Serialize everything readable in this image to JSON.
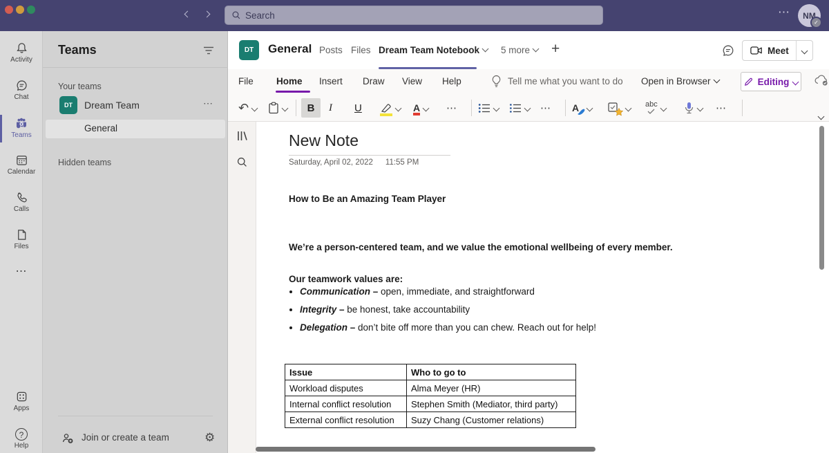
{
  "glyphs": {
    "ellipsis": "⋯",
    "plus": "+",
    "undo": "↶",
    "question": "?",
    "gear": "⚙",
    "check": "✓"
  },
  "colors": {
    "titlebar_bg": "#454370",
    "teams_accent": "#6062a5",
    "onenote_purple": "#7719aa",
    "team_avatar_teal": "#1a7d70",
    "traffic_red": "#d35d52",
    "traffic_yellow": "#cf9b3e",
    "traffic_green": "#2f8a5f"
  },
  "titlebar": {
    "search_placeholder": "Search",
    "avatar_initials": "NM"
  },
  "rail": {
    "items": [
      {
        "label": "Activity"
      },
      {
        "label": "Chat"
      },
      {
        "label": "Teams"
      },
      {
        "label": "Calendar"
      },
      {
        "label": "Calls"
      },
      {
        "label": "Files"
      }
    ],
    "bottom_items": [
      {
        "label": "Apps"
      },
      {
        "label": "Help"
      }
    ]
  },
  "sidebar": {
    "title": "Teams",
    "your_teams_label": "Your teams",
    "team": {
      "initials": "DT",
      "name": "Dream Team"
    },
    "channel": "General",
    "hidden_teams_label": "Hidden teams",
    "join_label": "Join or create a team"
  },
  "channel_header": {
    "team_initials": "DT",
    "title": "General",
    "tabs": [
      {
        "label": "Posts"
      },
      {
        "label": "Files"
      },
      {
        "label": "Dream Team Notebook"
      }
    ],
    "more_tabs_label": "5 more",
    "meet_label": "Meet"
  },
  "ribbon": {
    "menus": [
      {
        "label": "File"
      },
      {
        "label": "Home"
      },
      {
        "label": "Insert"
      },
      {
        "label": "Draw"
      },
      {
        "label": "View"
      },
      {
        "label": "Help"
      }
    ],
    "tell_me_label": "Tell me what you want to do",
    "open_in_browser_label": "Open in Browser",
    "editing_label": "Editing"
  },
  "toolbar": {
    "bold_label": "B",
    "italic_label": "I",
    "underline_label": "U",
    "fontcolor_label": "A",
    "styles_label": "A",
    "abc_label": "abc"
  },
  "note": {
    "title": "New Note",
    "date": "Saturday, April 02, 2022",
    "time": "11:55 PM",
    "heading": "How to Be an Amazing Team Player",
    "paragraph": "We’re a person-centered team, and we value the emotional wellbeing of every member.",
    "values_intro": "Our teamwork values are:",
    "bullets": [
      {
        "term": "Communication",
        "sep": " – ",
        "desc": "open, immediate, and straightforward"
      },
      {
        "term": "Integrity",
        "sep": " – ",
        "desc": "be honest, take accountability"
      },
      {
        "term": "Delegation",
        "sep": " – ",
        "desc": "don’t bite off more than you can chew. Reach out for help!"
      }
    ],
    "table": {
      "headers": [
        "Issue",
        "Who to go to"
      ],
      "rows": [
        [
          "Workload disputes",
          "Alma Meyer (HR)"
        ],
        [
          "Internal conflict resolution",
          "Stephen Smith (Mediator, third party)"
        ],
        [
          "External conflict resolution",
          "Suzy Chang (Customer relations)"
        ]
      ]
    }
  }
}
